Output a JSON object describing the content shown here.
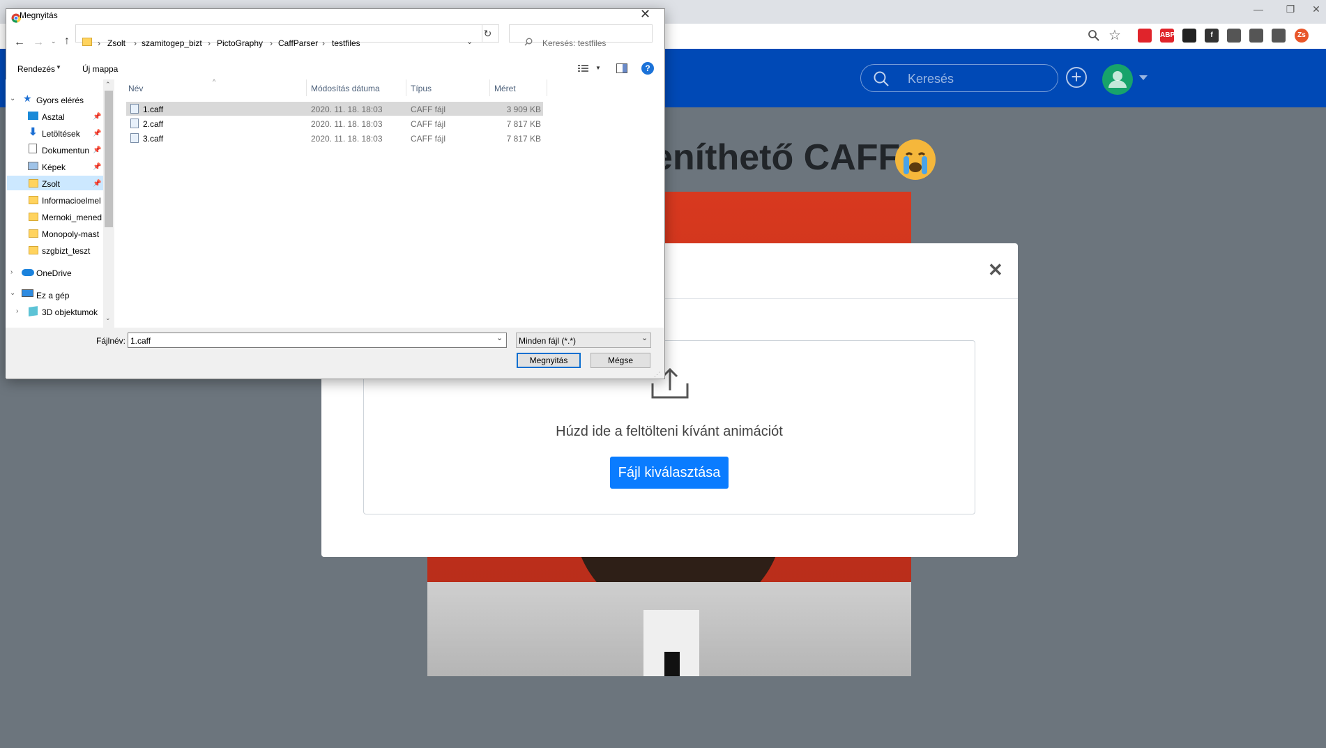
{
  "browser": {
    "window_controls": {
      "minimize": "—",
      "restore": "❐",
      "close": "✕"
    },
    "extensions": [
      {
        "name": "ublock-icon",
        "label": "",
        "color": "#e0242b"
      },
      {
        "name": "adblock-icon",
        "label": "ABP",
        "color": "#e0242b"
      },
      {
        "name": "trello-icon",
        "label": "",
        "color": "#222222"
      },
      {
        "name": "facebook-icon",
        "label": "f",
        "color": "#333333"
      },
      {
        "name": "news-icon",
        "label": "",
        "color": "#555555"
      },
      {
        "name": "circle-icon",
        "label": "",
        "color": "#555555"
      },
      {
        "name": "puzzle-icon",
        "label": "",
        "color": "#555555"
      },
      {
        "name": "profile-icon",
        "label": "Zs",
        "color": "#e8562a"
      }
    ]
  },
  "app": {
    "search_placeholder": "Keresés",
    "page_title": "eníthető CAFF",
    "modal": {
      "close": "✕",
      "drop_text": "Húzd ide a feltölteni kívánt animációt",
      "pick_button": "Fájl kiválasztása"
    },
    "colors": {
      "navbar": "#0049b6",
      "primary": "#0a7cff",
      "backdrop": "#6c757d"
    }
  },
  "dialog": {
    "title": "Megnyitás",
    "breadcrumb": [
      "Zsolt",
      "szamitogep_bizt",
      "PictoGraphy",
      "CaffParser",
      "testfiles"
    ],
    "search_placeholder": "Keresés: testfiles",
    "toolbar": {
      "organize": "Rendezés",
      "new_folder": "Új mappa",
      "help": "?"
    },
    "columns": {
      "name": "Név",
      "modified": "Módosítás dátuma",
      "type": "Típus",
      "size": "Méret"
    },
    "files": [
      {
        "name": "1.caff",
        "modified": "2020. 11. 18. 18:03",
        "type": "CAFF fájl",
        "size": "3 909 KB"
      },
      {
        "name": "2.caff",
        "modified": "2020. 11. 18. 18:03",
        "type": "CAFF fájl",
        "size": "7 817 KB"
      },
      {
        "name": "3.caff",
        "modified": "2020. 11. 18. 18:03",
        "type": "CAFF fájl",
        "size": "7 817 KB"
      }
    ],
    "nav": {
      "quick_access": "Gyors elérés",
      "items": [
        "Asztal",
        "Letöltések",
        "Dokumentun",
        "Képek",
        "Zsolt",
        "Informacioelmel",
        "Mernoki_mened",
        "Monopoly-mast",
        "szgbizt_teszt"
      ],
      "onedrive": "OneDrive",
      "this_pc": "Ez a gép",
      "objects3d": "3D objektumok"
    },
    "filename_label": "Fájlnév:",
    "filename_value": "1.caff",
    "filter_value": "Minden fájl (*.*)",
    "open_button": "Megnyitás",
    "cancel_button": "Mégse"
  }
}
